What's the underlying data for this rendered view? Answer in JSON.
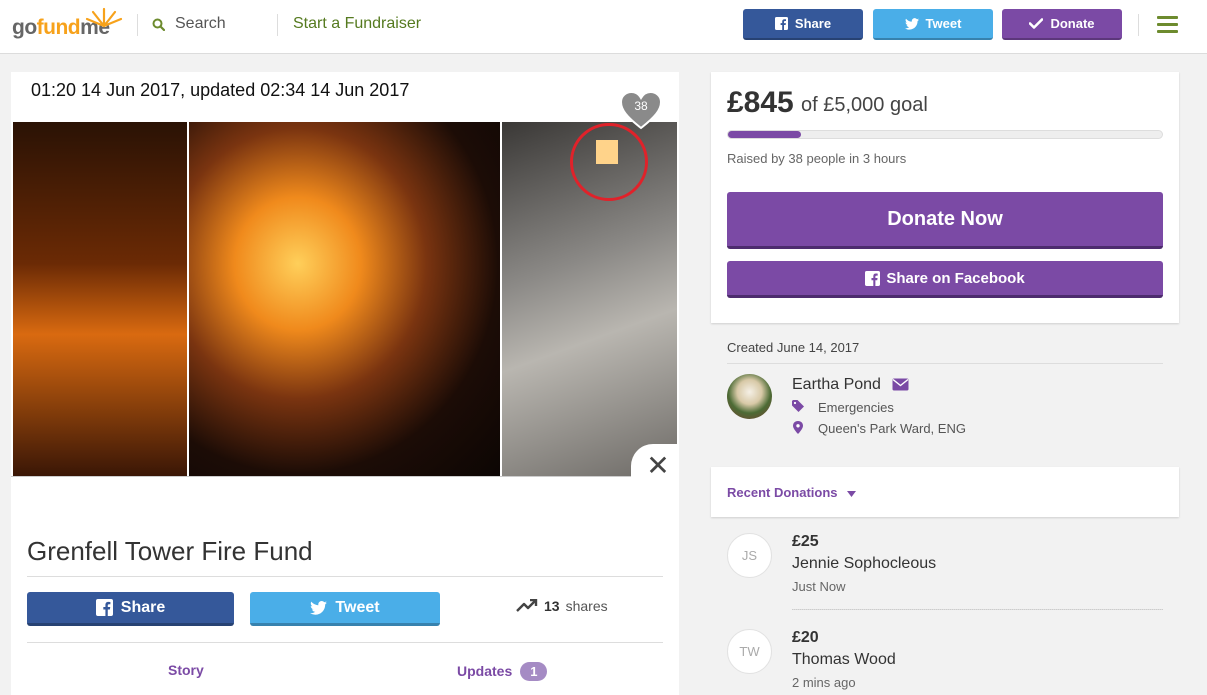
{
  "header": {
    "logo": {
      "go": "go",
      "fund": "fund",
      "me": "me"
    },
    "search_label": "Search",
    "start_label": "Start a Fundraiser",
    "share_label": "Share",
    "tweet_label": "Tweet",
    "donate_label": "Donate"
  },
  "media": {
    "timestamp": "01:20 14 Jun 2017, updated 02:34 14 Jun 2017",
    "hearts": "38",
    "close_glyph": "✕"
  },
  "campaign": {
    "title": "Grenfell Tower Fire Fund",
    "share_label": "Share",
    "tweet_label": "Tweet",
    "shares_count": "13",
    "shares_label": "shares",
    "tabs": [
      {
        "label": "Story"
      },
      {
        "label": "Updates",
        "badge": "1"
      }
    ]
  },
  "goal": {
    "raised": "£845",
    "goal_text": "of £5,000 goal",
    "progress_fraction": 0.169,
    "raised_by": "Raised by 38 people in 3 hours",
    "donate_now_label": "Donate Now",
    "facebook_share_label": "Share on Facebook"
  },
  "meta": {
    "created": "Created June 14, 2017",
    "organizer": "Eartha Pond",
    "category": "Emergencies",
    "location": "Queen's Park Ward, ENG"
  },
  "recent": {
    "label": "Recent Donations",
    "donations": [
      {
        "initials": "JS",
        "amount": "£25",
        "name": "Jennie Sophocleous",
        "time": "Just Now"
      },
      {
        "initials": "TW",
        "amount": "£20",
        "name": "Thomas Wood",
        "time": "2 mins ago"
      }
    ]
  },
  "colors": {
    "brand_green": "#6d8b2e",
    "brand_orange": "#f7a21b",
    "purple": "#7b4aa5",
    "facebook": "#35589a",
    "twitter": "#4aaee8"
  }
}
